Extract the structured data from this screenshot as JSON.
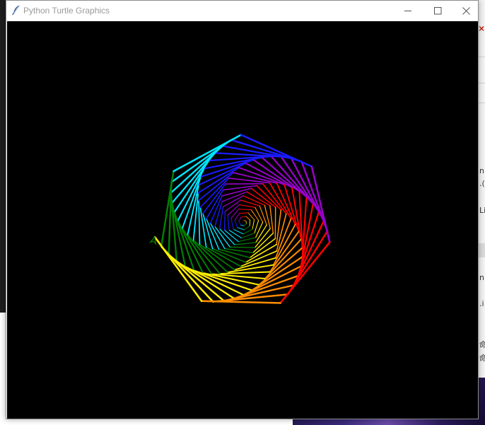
{
  "window": {
    "title": "Python Turtle Graphics",
    "icon": "feather-icon",
    "controls": [
      "minimize-icon",
      "maximize-icon",
      "close-icon"
    ]
  },
  "canvas": {
    "background": "#000000",
    "drawing": "rainbow-spiral-heptagon",
    "polygon_sides": 7,
    "spiral_segments": 150,
    "colors": [
      "#ff0000",
      "#ff8c00",
      "#ffee00",
      "#008000",
      "#00e5ff",
      "#1a1aff",
      "#9900cc"
    ],
    "cursor_color": "#008000"
  },
  "background_fragments": {
    "right_strip_text": [
      "n",
      ".(",
      "Li",
      "n:",
      ".i",
      "命",
      "命"
    ],
    "accent_color": "#c42b1c"
  }
}
